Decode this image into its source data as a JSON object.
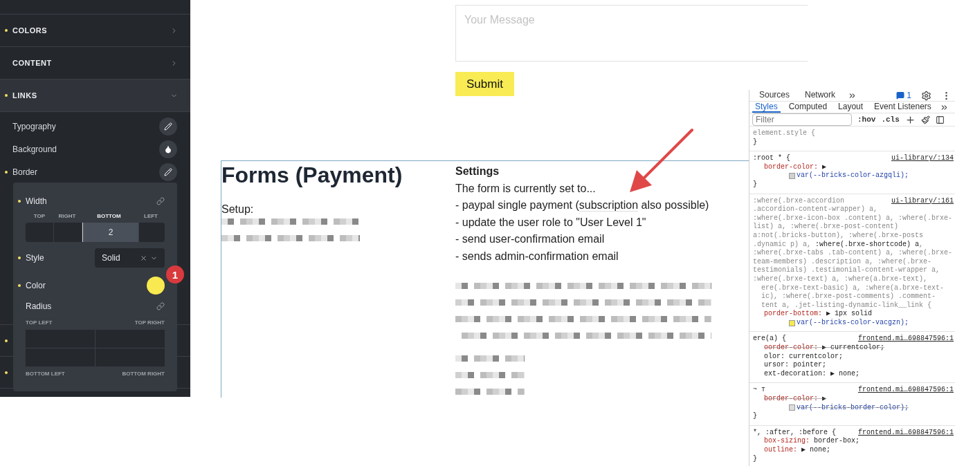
{
  "sidebar": {
    "sections": [
      {
        "title": "COLORS",
        "modified": true,
        "expanded": false
      },
      {
        "title": "CONTENT",
        "modified": false,
        "expanded": false
      },
      {
        "title": "LINKS",
        "modified": true,
        "expanded": true,
        "items": [
          {
            "label": "Typography",
            "modified": false,
            "kind": "edit"
          },
          {
            "label": "Background",
            "modified": false,
            "kind": "fill"
          },
          {
            "label": "Border",
            "modified": true,
            "kind": "edit"
          }
        ]
      }
    ],
    "hidden_rows": [
      {
        "modified": true
      },
      {
        "modified": true
      }
    ]
  },
  "border_popover": {
    "width": {
      "label": "Width",
      "modified": true,
      "sides": [
        {
          "label": "TOP",
          "selected": false
        },
        {
          "label": "RIGHT",
          "selected": false
        },
        {
          "label": "BOTTOM",
          "selected": true,
          "value": "2"
        },
        {
          "label": "LEFT",
          "selected": false
        }
      ]
    },
    "style": {
      "label": "Style",
      "modified": true,
      "value": "Solid"
    },
    "color": {
      "label": "Color",
      "modified": true,
      "color": "#f7e94f",
      "annotation_badge": "1"
    },
    "radius": {
      "label": "Radius",
      "modified": false,
      "corners": [
        "TOP LEFT",
        "TOP RIGHT",
        "BOTTOM LEFT",
        "BOTTOM RIGHT"
      ]
    }
  },
  "page": {
    "message_field": {
      "placeholder": "Your Message"
    },
    "submit_button": "Submit",
    "section": {
      "title": "Forms (Payment)",
      "setup_label": "Setup:",
      "settings": {
        "heading": "Settings",
        "intro": "The form is currently set to...",
        "lines": [
          {
            "before": "- paypal single payment (",
            "link": "subscription",
            "after": " also possible)"
          },
          {
            "before": "- update the user role to \"User Level 1\""
          },
          {
            "before": "- send user-confirmation email"
          },
          {
            "before": "- sends admin-confirmation email"
          }
        ]
      }
    }
  },
  "devtools": {
    "top_tabs": [
      {
        "label": "Sources",
        "selected": false
      },
      {
        "label": "Network",
        "selected": false
      }
    ],
    "messages": "1",
    "style_tabs": [
      {
        "label": "Styles",
        "selected": true
      },
      {
        "label": "Computed",
        "selected": false
      },
      {
        "label": "Layout",
        "selected": false
      },
      {
        "label": "Event Listeners",
        "selected": false
      }
    ],
    "filter": {
      "placeholder": "Filter"
    },
    "toggles": [
      ":hov",
      ".cls"
    ],
    "rules": [
      {
        "selector": [
          "element.style {"
        ],
        "closing": "}"
      },
      {
        "selector": [
          ":root * {"
        ],
        "source": "ui-library/:134",
        "declarations": [
          {
            "property": "border-color:",
            "value": "▶",
            "struck": false,
            "swatch": {
              "color": "#d0d0d0",
              "value": "var(--bricks-color-azgqli);"
            }
          }
        ],
        "closing": "}"
      },
      {
        "selector": [
          ":where(.brxe-accordion",
          ".accordion-content-wrapper) a,",
          ":where(.brxe-icon-box .content) a, :where(.brxe-",
          "list) a, :where(.brxe-post-content)",
          "a:not(.bricks-button), :where(.brxe-posts",
          ".dynamic p) a, **:where(.brxe-shortcode) a**,",
          ":where(.brxe-tabs .tab-content) a, :where(.brxe-",
          "team-members) .description a, :where(.brxe-",
          "testimonials) .testimonial-content-wrapper a,",
          ":where(.brxe-text) a, :where(a.brxe-text),",
          "  ere(.brxe-text-basic) a, :where(a.brxe-text-",
          "  ic), :where(.brxe-post-comments) .comment-",
          "  tent a, .jet-listing-dynamic-link__link {"
        ],
        "source": "ui-library/:161",
        "declarations": [
          {
            "property": "porder-bottom:",
            "value": "▶ 1px solid",
            "struck": false,
            "swatch": {
              "color": "#f7e94f",
              "value": "var(--bricks-color-vacgzn);"
            }
          }
        ]
      },
      {
        "selector": [
          "ere(a) {"
        ],
        "source": "frontend.mi…698847596:1",
        "declarations": [
          {
            "property": "oorder-color:",
            "value": "▶ currentcolor;",
            "struck": true
          },
          {
            "property": "olor:",
            "value": "currentcolor;",
            "struck": false
          },
          {
            "property": "ursor:",
            "value": "pointer;",
            "struck": false
          },
          {
            "property": "ext-decoration:",
            "value": "▶ none;",
            "struck": false
          }
        ]
      },
      {
        "selector": [
          "~ т"
        ],
        "source": "frontend.mi…698847596:1",
        "declarations": [
          {
            "property": "border-color:",
            "value": "▶",
            "struck": true,
            "swatch": {
              "color": "#dddddd",
              "value": "var(--bricks-border-color);"
            }
          }
        ],
        "closing": "}"
      },
      {
        "selector": [
          "*, :after, :before {"
        ],
        "source": "frontend.mi…698847596:1",
        "declarations": [
          {
            "property": "box-sizing:",
            "value": "border-box;",
            "struck": false
          },
          {
            "property": "outline:",
            "value": "▶ none;",
            "struck": false
          }
        ],
        "closing": "}"
      }
    ]
  }
}
